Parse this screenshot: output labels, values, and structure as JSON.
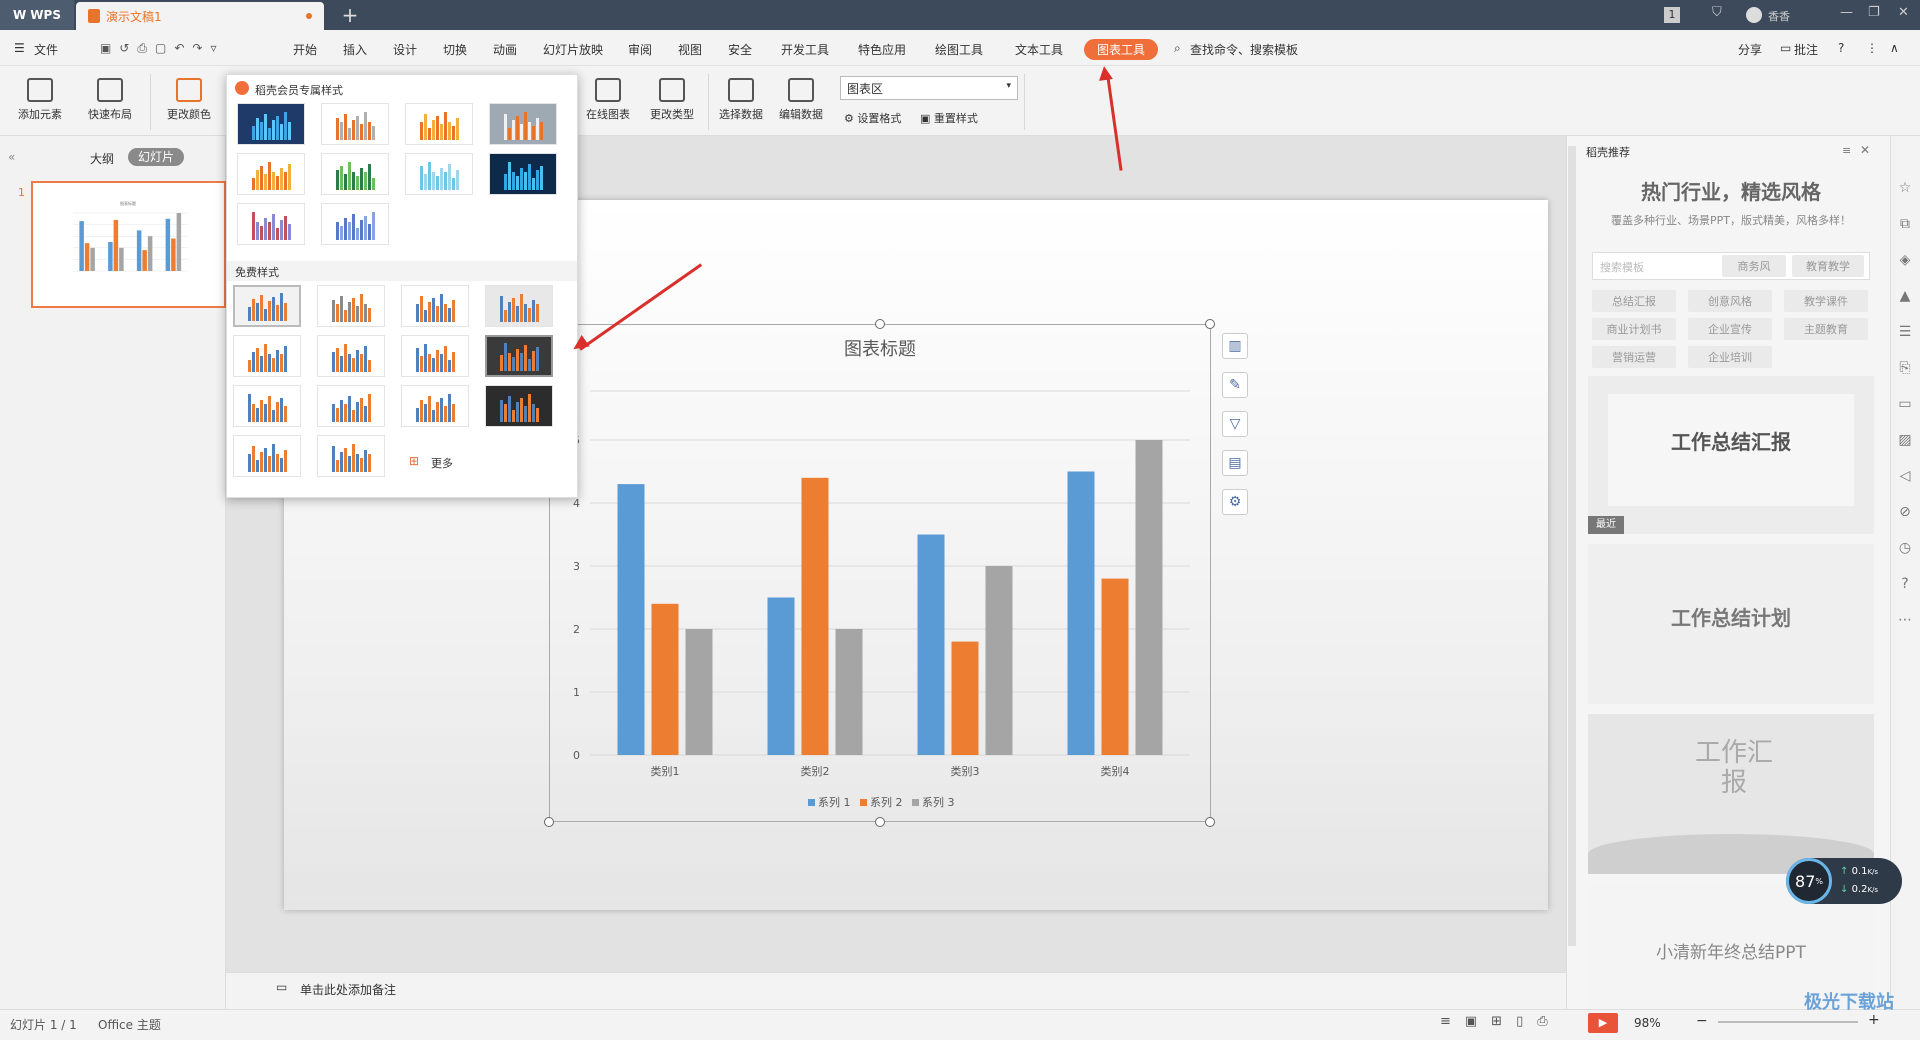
{
  "titlebar": {
    "app": "WPS",
    "doc_tab": "演示文稿1",
    "new_tab": "+",
    "user": "香香",
    "count_badge": "1"
  },
  "menu": {
    "file": "文件",
    "items": [
      "开始",
      "插入",
      "设计",
      "切换",
      "动画",
      "幻灯片放映",
      "审阅",
      "视图",
      "安全",
      "开发工具",
      "特色应用",
      "绘图工具",
      "文本工具"
    ],
    "active": "图表工具",
    "search": "查找命令、搜索模板",
    "share": "分享",
    "comment": "批注"
  },
  "ribbon": {
    "add_element": "添加元素",
    "quick_layout": "快速布局",
    "change_color": "更改颜色",
    "online_chart": "在线图表",
    "change_type": "更改类型",
    "select_data": "选择数据",
    "edit_data": "编辑数据",
    "area_select": "图表区",
    "set_format": "设置格式",
    "reset_style": "重置样式"
  },
  "leftpanel": {
    "outline": "大纲",
    "slides": "幻灯片",
    "slide_number": "1"
  },
  "dropdown": {
    "member_header": "稻壳会员专属样式",
    "free_header": "免费样式",
    "more": "更多"
  },
  "chart_data": {
    "type": "bar",
    "title": "图表标题",
    "categories": [
      "类别1",
      "类别2",
      "类别3",
      "类别4"
    ],
    "series": [
      {
        "name": "系列 1",
        "color": "#5b9bd5",
        "values": [
          4.3,
          2.5,
          3.5,
          4.5
        ]
      },
      {
        "name": "系列 2",
        "color": "#ed7d31",
        "values": [
          2.4,
          4.4,
          1.8,
          2.8
        ]
      },
      {
        "name": "系列 3",
        "color": "#a5a5a5",
        "values": [
          2,
          2,
          3,
          5
        ]
      }
    ],
    "ylim": [
      0,
      5
    ],
    "y_ticks": [
      "0",
      "1",
      "2",
      "3",
      "4",
      "5"
    ],
    "legend": "bottom",
    "grid": true
  },
  "notes": {
    "placeholder": "单击此处添加备注"
  },
  "status": {
    "slide_info": "幻灯片 1 / 1",
    "theme": "Office 主题",
    "zoom": "98%"
  },
  "rightpanel": {
    "header": "稻壳推荐",
    "headline": "热门行业，精选风格",
    "subline": "覆盖多种行业、场景PPT，版式精美，风格多样！",
    "search_placeholder": "搜索模板",
    "tags_row1": [
      "商务风",
      "教育教学"
    ],
    "tags": [
      "总结汇报",
      "创意风格",
      "教学课件",
      "商业计划书",
      "企业宣传",
      "主题教育",
      "营销运营",
      "企业培训"
    ],
    "cards": [
      "工作总结汇报",
      "工作总结计划",
      "工作汇报",
      "小清新年终总结PPT"
    ],
    "recent": "最近"
  },
  "speed": {
    "percent": "87",
    "unit": "%",
    "up": "0.1",
    "down": "0.2",
    "rate_unit": "K/s"
  },
  "watermark": "极光下载站"
}
